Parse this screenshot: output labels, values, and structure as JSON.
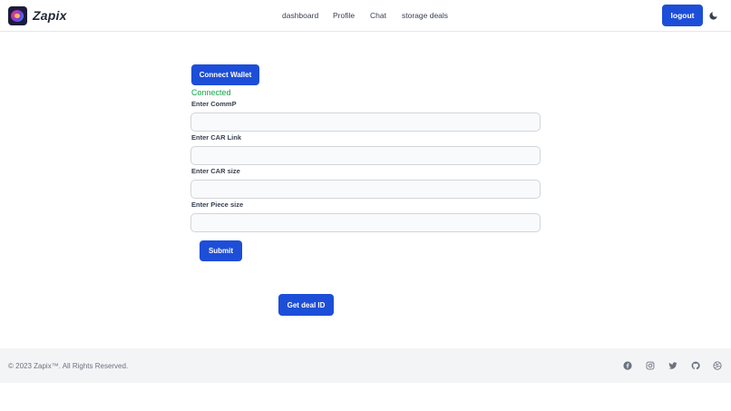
{
  "header": {
    "brand": "Zapix",
    "nav": [
      {
        "label": "dashboard"
      },
      {
        "label": "Profile"
      },
      {
        "label": "Chat"
      },
      {
        "label": "storage deals"
      }
    ],
    "logout_label": "logout",
    "theme_icon": "moon-icon"
  },
  "form": {
    "connect_label": "Connect Wallet",
    "status": "Connected",
    "fields": [
      {
        "label": "Enter CommP",
        "value": ""
      },
      {
        "label": "Enter CAR Link",
        "value": ""
      },
      {
        "label": "Enter CAR size",
        "value": ""
      },
      {
        "label": "Enter Piece size",
        "value": ""
      }
    ],
    "submit_label": "Submit",
    "deal_label": "Get deal ID"
  },
  "footer": {
    "copyright": "© 2023 Zapix™. All Rights Reserved.",
    "social_icons": [
      "facebook-icon",
      "instagram-icon",
      "twitter-icon",
      "github-icon",
      "dribbble-icon"
    ]
  },
  "colors": {
    "primary": "#1d4ed8",
    "status_green": "#16a34a",
    "footer_bg": "#f3f4f6"
  }
}
